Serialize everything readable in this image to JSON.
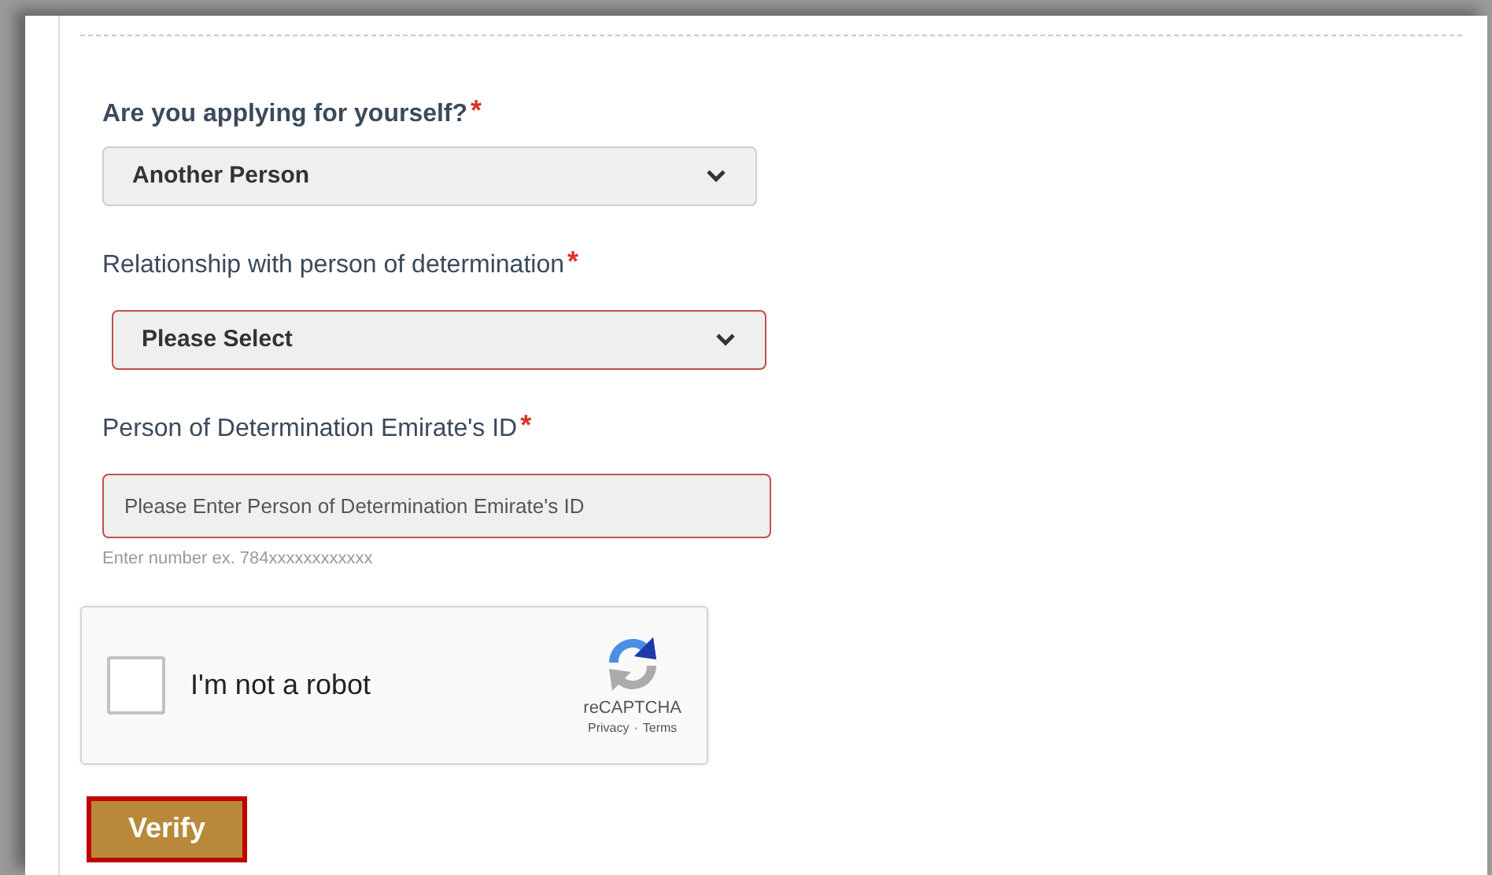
{
  "fields": [
    {
      "kind": "select",
      "label": "Are you applying for yourself?",
      "required_mark": "*",
      "bold_label": true,
      "invalid": false,
      "value": "Another Person"
    },
    {
      "kind": "select",
      "label": "Relationship with person of determination",
      "required_mark": "*",
      "bold_label": false,
      "invalid": true,
      "value": "Please Select"
    },
    {
      "kind": "text",
      "label": "Person of Determination Emirate's ID",
      "required_mark": "*",
      "bold_label": false,
      "invalid": true,
      "placeholder": "Please Enter Person of Determination Emirate's ID",
      "hint": "Enter number ex. 784xxxxxxxxxxxx"
    }
  ],
  "captcha": {
    "checked": false,
    "label": "I'm not a robot",
    "brand": "reCAPTCHA",
    "links": [
      "Privacy",
      "Terms"
    ],
    "separator": "·"
  },
  "submit": {
    "label": "Verify"
  }
}
